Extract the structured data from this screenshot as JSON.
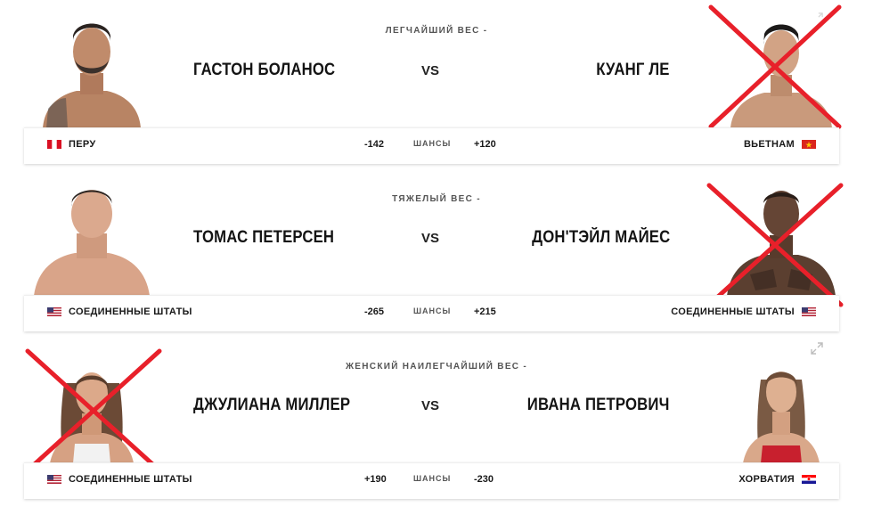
{
  "bouts": [
    {
      "weight_class": "ЛЕГЧАЙШИЙ ВЕС -",
      "red": {
        "name": "ГАСТОН БОЛАНОС",
        "country": "ПЕРУ",
        "flag": "peru-flag",
        "odds": "-142",
        "crossed": false
      },
      "vs": "VS",
      "odds_label": "ШАНСЫ",
      "blue": {
        "name": "КУАНГ ЛЕ",
        "country": "ВЬЕТНАМ",
        "flag": "vietnam-flag",
        "odds": "+120",
        "crossed": true
      }
    },
    {
      "weight_class": "ТЯЖЕЛЫЙ ВЕС -",
      "red": {
        "name": "ТОМАС ПЕТЕРСЕН",
        "country": "СОЕДИНЕННЫЕ ШТАТЫ",
        "flag": "usa-flag",
        "odds": "-265",
        "crossed": false
      },
      "vs": "VS",
      "odds_label": "ШАНСЫ",
      "blue": {
        "name": "ДОН'ТЭЙЛ МАЙЕС",
        "country": "СОЕДИНЕННЫЕ ШТАТЫ",
        "flag": "usa-flag",
        "odds": "+215",
        "crossed": true
      }
    },
    {
      "weight_class": "ЖЕНСКИЙ НАИЛЕГЧАЙШИЙ ВЕС -",
      "red": {
        "name": "ДЖУЛИАНА МИЛЛЕР",
        "country": "СОЕДИНЕННЫЕ ШТАТЫ",
        "flag": "usa-flag",
        "odds": "+190",
        "crossed": true
      },
      "vs": "VS",
      "odds_label": "ШАНСЫ",
      "blue": {
        "name": "ИВАНА ПЕТРОВИЧ",
        "country": "ХОРВАТИЯ",
        "flag": "croatia-flag",
        "odds": "-230",
        "crossed": false
      }
    }
  ],
  "colors": {
    "cross": "#e8202a",
    "text": "#191919",
    "muted": "#555555",
    "skin": "#c99a7c"
  }
}
